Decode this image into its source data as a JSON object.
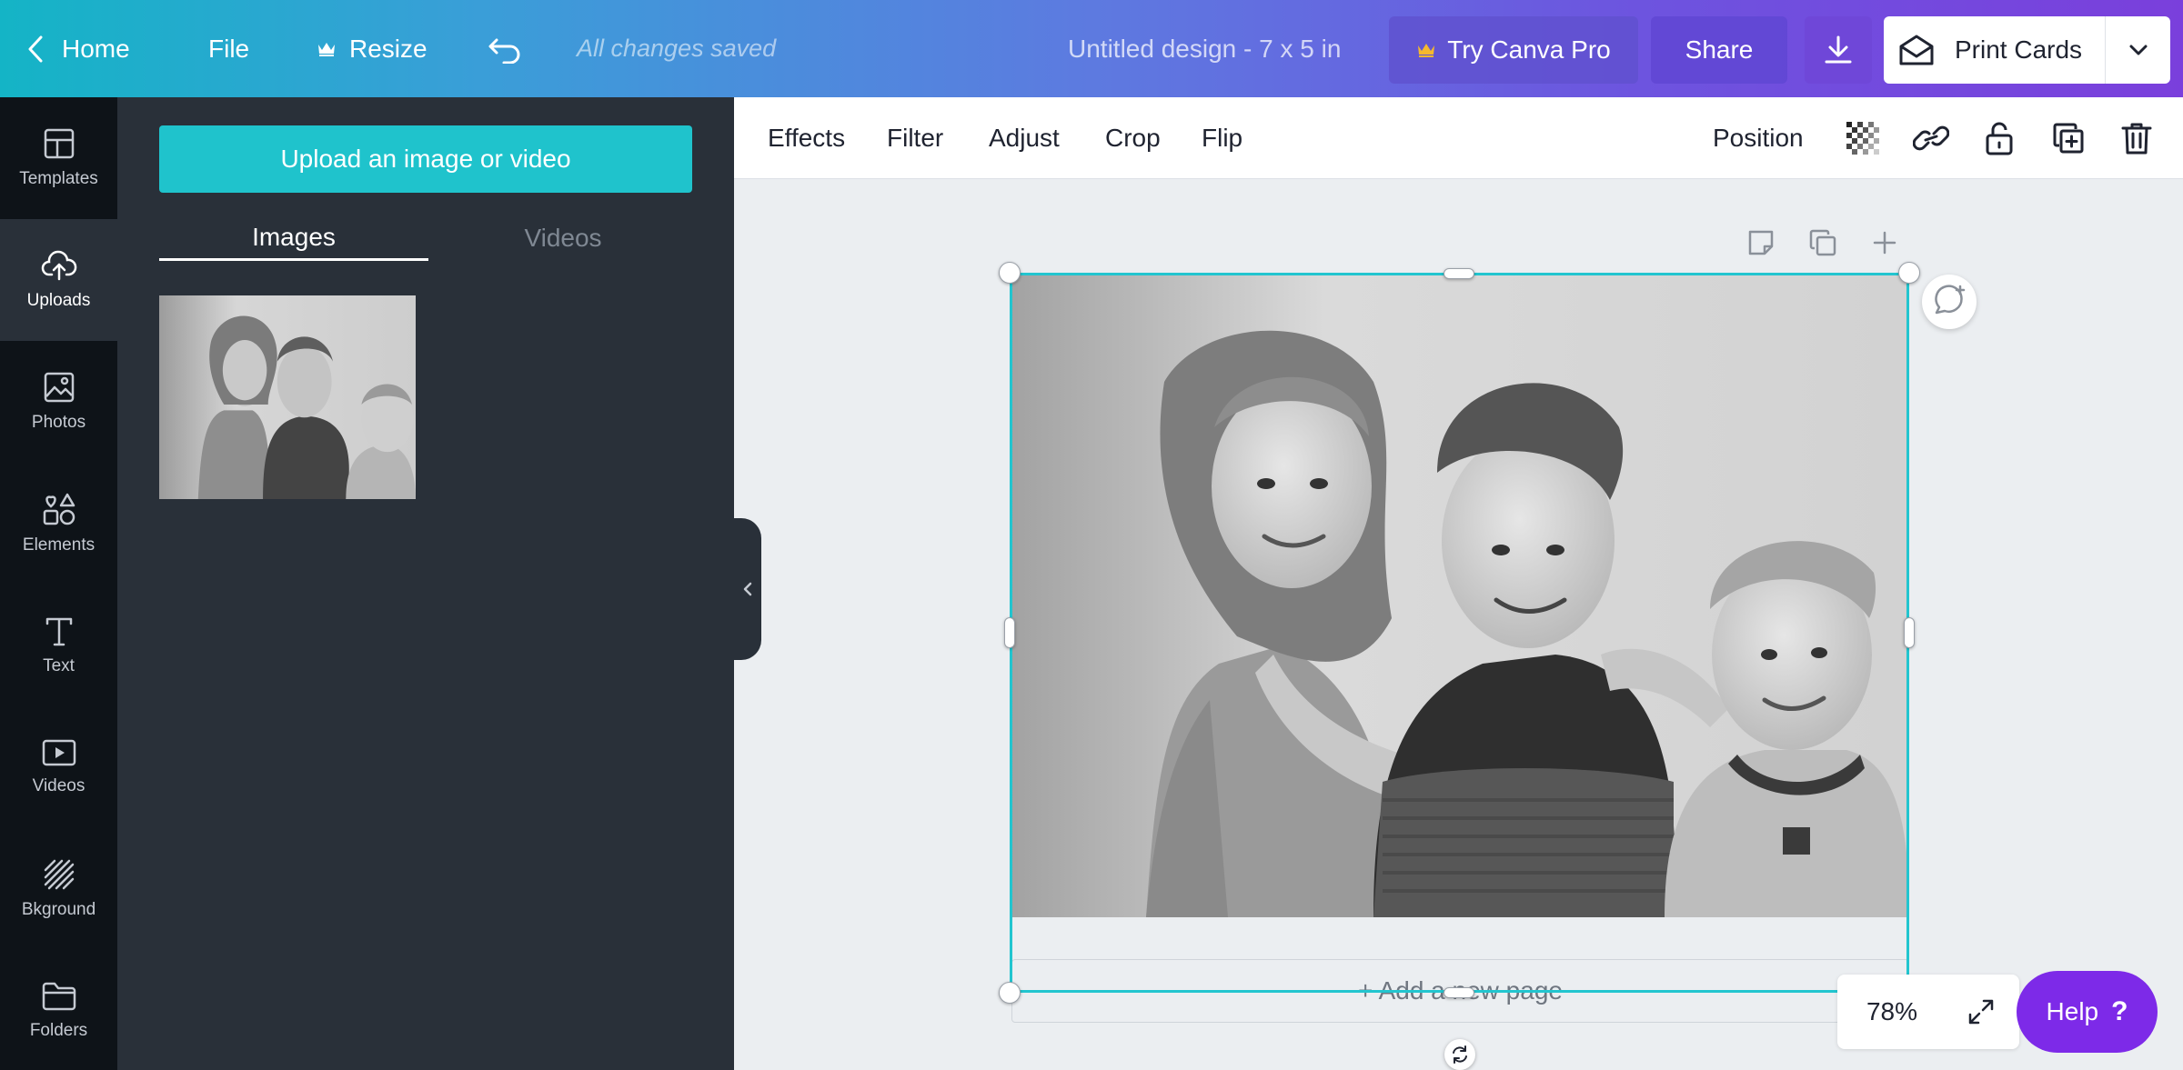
{
  "topbar": {
    "home_label": "Home",
    "file_label": "File",
    "resize_label": "Resize",
    "saved_status": "All changes saved",
    "doc_title": "Untitled design - 7 x 5 in",
    "try_pro_label": "Try Canva Pro",
    "share_label": "Share",
    "print_label": "Print Cards"
  },
  "leftnav": {
    "items": [
      {
        "label": "Templates",
        "icon": "templates-icon"
      },
      {
        "label": "Uploads",
        "icon": "upload-cloud-icon",
        "active": true
      },
      {
        "label": "Photos",
        "icon": "photo-icon"
      },
      {
        "label": "Elements",
        "icon": "elements-icon"
      },
      {
        "label": "Text",
        "icon": "text-icon"
      },
      {
        "label": "Videos",
        "icon": "video-icon"
      },
      {
        "label": "Bkground",
        "icon": "background-icon"
      },
      {
        "label": "Folders",
        "icon": "folder-icon"
      }
    ]
  },
  "panel": {
    "upload_label": "Upload an image or video",
    "tabs": [
      {
        "label": "Images",
        "active": true
      },
      {
        "label": "Videos",
        "active": false
      }
    ]
  },
  "imagebar": {
    "effects": "Effects",
    "filter": "Filter",
    "adjust": "Adjust",
    "crop": "Crop",
    "flip": "Flip",
    "position": "Position"
  },
  "canvas": {
    "add_page_label": "+ Add a new page"
  },
  "zoom": {
    "value": "78%"
  },
  "help": {
    "label": "Help",
    "glyph": "?"
  },
  "colors": {
    "accent": "#1fc3cc",
    "selection": "#22c5cf",
    "help": "#7d2ae8",
    "sidebar": "#0e1318",
    "panel": "#293039"
  }
}
